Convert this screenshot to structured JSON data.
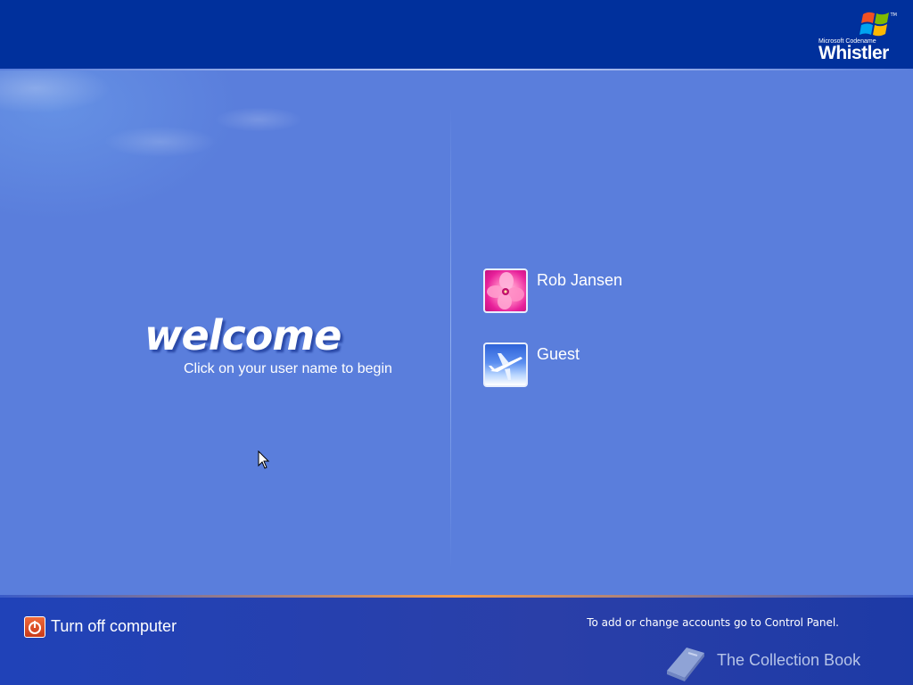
{
  "header": {
    "brand_small": "Microsoft Codename",
    "brand_big": "Whistler",
    "brand_tm": "TM"
  },
  "welcome": {
    "title": "welcome",
    "subtitle": "Click on your user name to begin"
  },
  "users": [
    {
      "name": "Rob Jansen",
      "picture": "pink-flower-picture"
    },
    {
      "name": "Guest",
      "picture": "airplane-picture"
    }
  ],
  "footer": {
    "turn_off_label": "Turn off computer",
    "accounts_hint": "To add or change accounts go to Control Panel.",
    "watermark": "The Collection Book"
  },
  "icons": {
    "power": "power-icon",
    "windows_flag": "windows-flag-icon",
    "book": "book-icon",
    "cursor": "mouse-pointer-icon"
  },
  "colors": {
    "top_bar": "#00309c",
    "main_background": "#5a7edc",
    "bottom_bar": "#2a3fa8",
    "accent_orange": "#f39a4c",
    "power_button": "#d94a25"
  }
}
